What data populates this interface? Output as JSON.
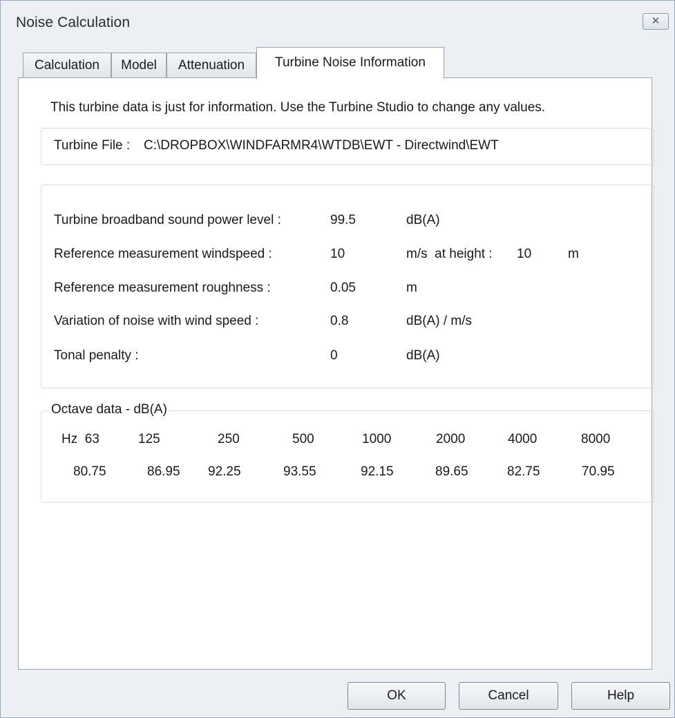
{
  "window": {
    "title": "Noise Calculation",
    "close_glyph": "✕"
  },
  "tabs": [
    {
      "label": "Calculation"
    },
    {
      "label": "Model"
    },
    {
      "label": "Attenuation"
    },
    {
      "label": "Turbine Noise Information",
      "active": true
    }
  ],
  "info_text": "This turbine data is just for information. Use the Turbine Studio to change any values.",
  "turbine_file": {
    "label": "Turbine File :",
    "path": "C:\\DROPBOX\\WINDFARMR4\\WTDB\\EWT - Directwind\\EWT"
  },
  "params": [
    {
      "label": "Turbine broadband sound power level :",
      "value": "99.5",
      "unit": "dB(A)"
    },
    {
      "label": "Reference measurement windspeed :",
      "value": "10",
      "unit": "m/s  at height :",
      "extra_value": "10",
      "extra_unit": "m"
    },
    {
      "label": "Reference measurement roughness :",
      "value": "0.05",
      "unit": "m"
    },
    {
      "label": "Variation of noise with wind speed :",
      "value": "0.8",
      "unit": "dB(A) / m/s"
    },
    {
      "label": "Tonal penalty :",
      "value": "0",
      "unit": "dB(A)"
    }
  ],
  "octave": {
    "title": "Octave data - dB(A)",
    "freqs": [
      "Hz  63",
      "125",
      "250",
      "500",
      "1000",
      "2000",
      "4000",
      "8000"
    ],
    "values": [
      "80.75",
      "86.95",
      "92.25",
      "93.55",
      "92.15",
      "89.65",
      "82.75",
      "70.95"
    ]
  },
  "buttons": {
    "ok": "OK",
    "cancel": "Cancel",
    "help": "Help"
  }
}
